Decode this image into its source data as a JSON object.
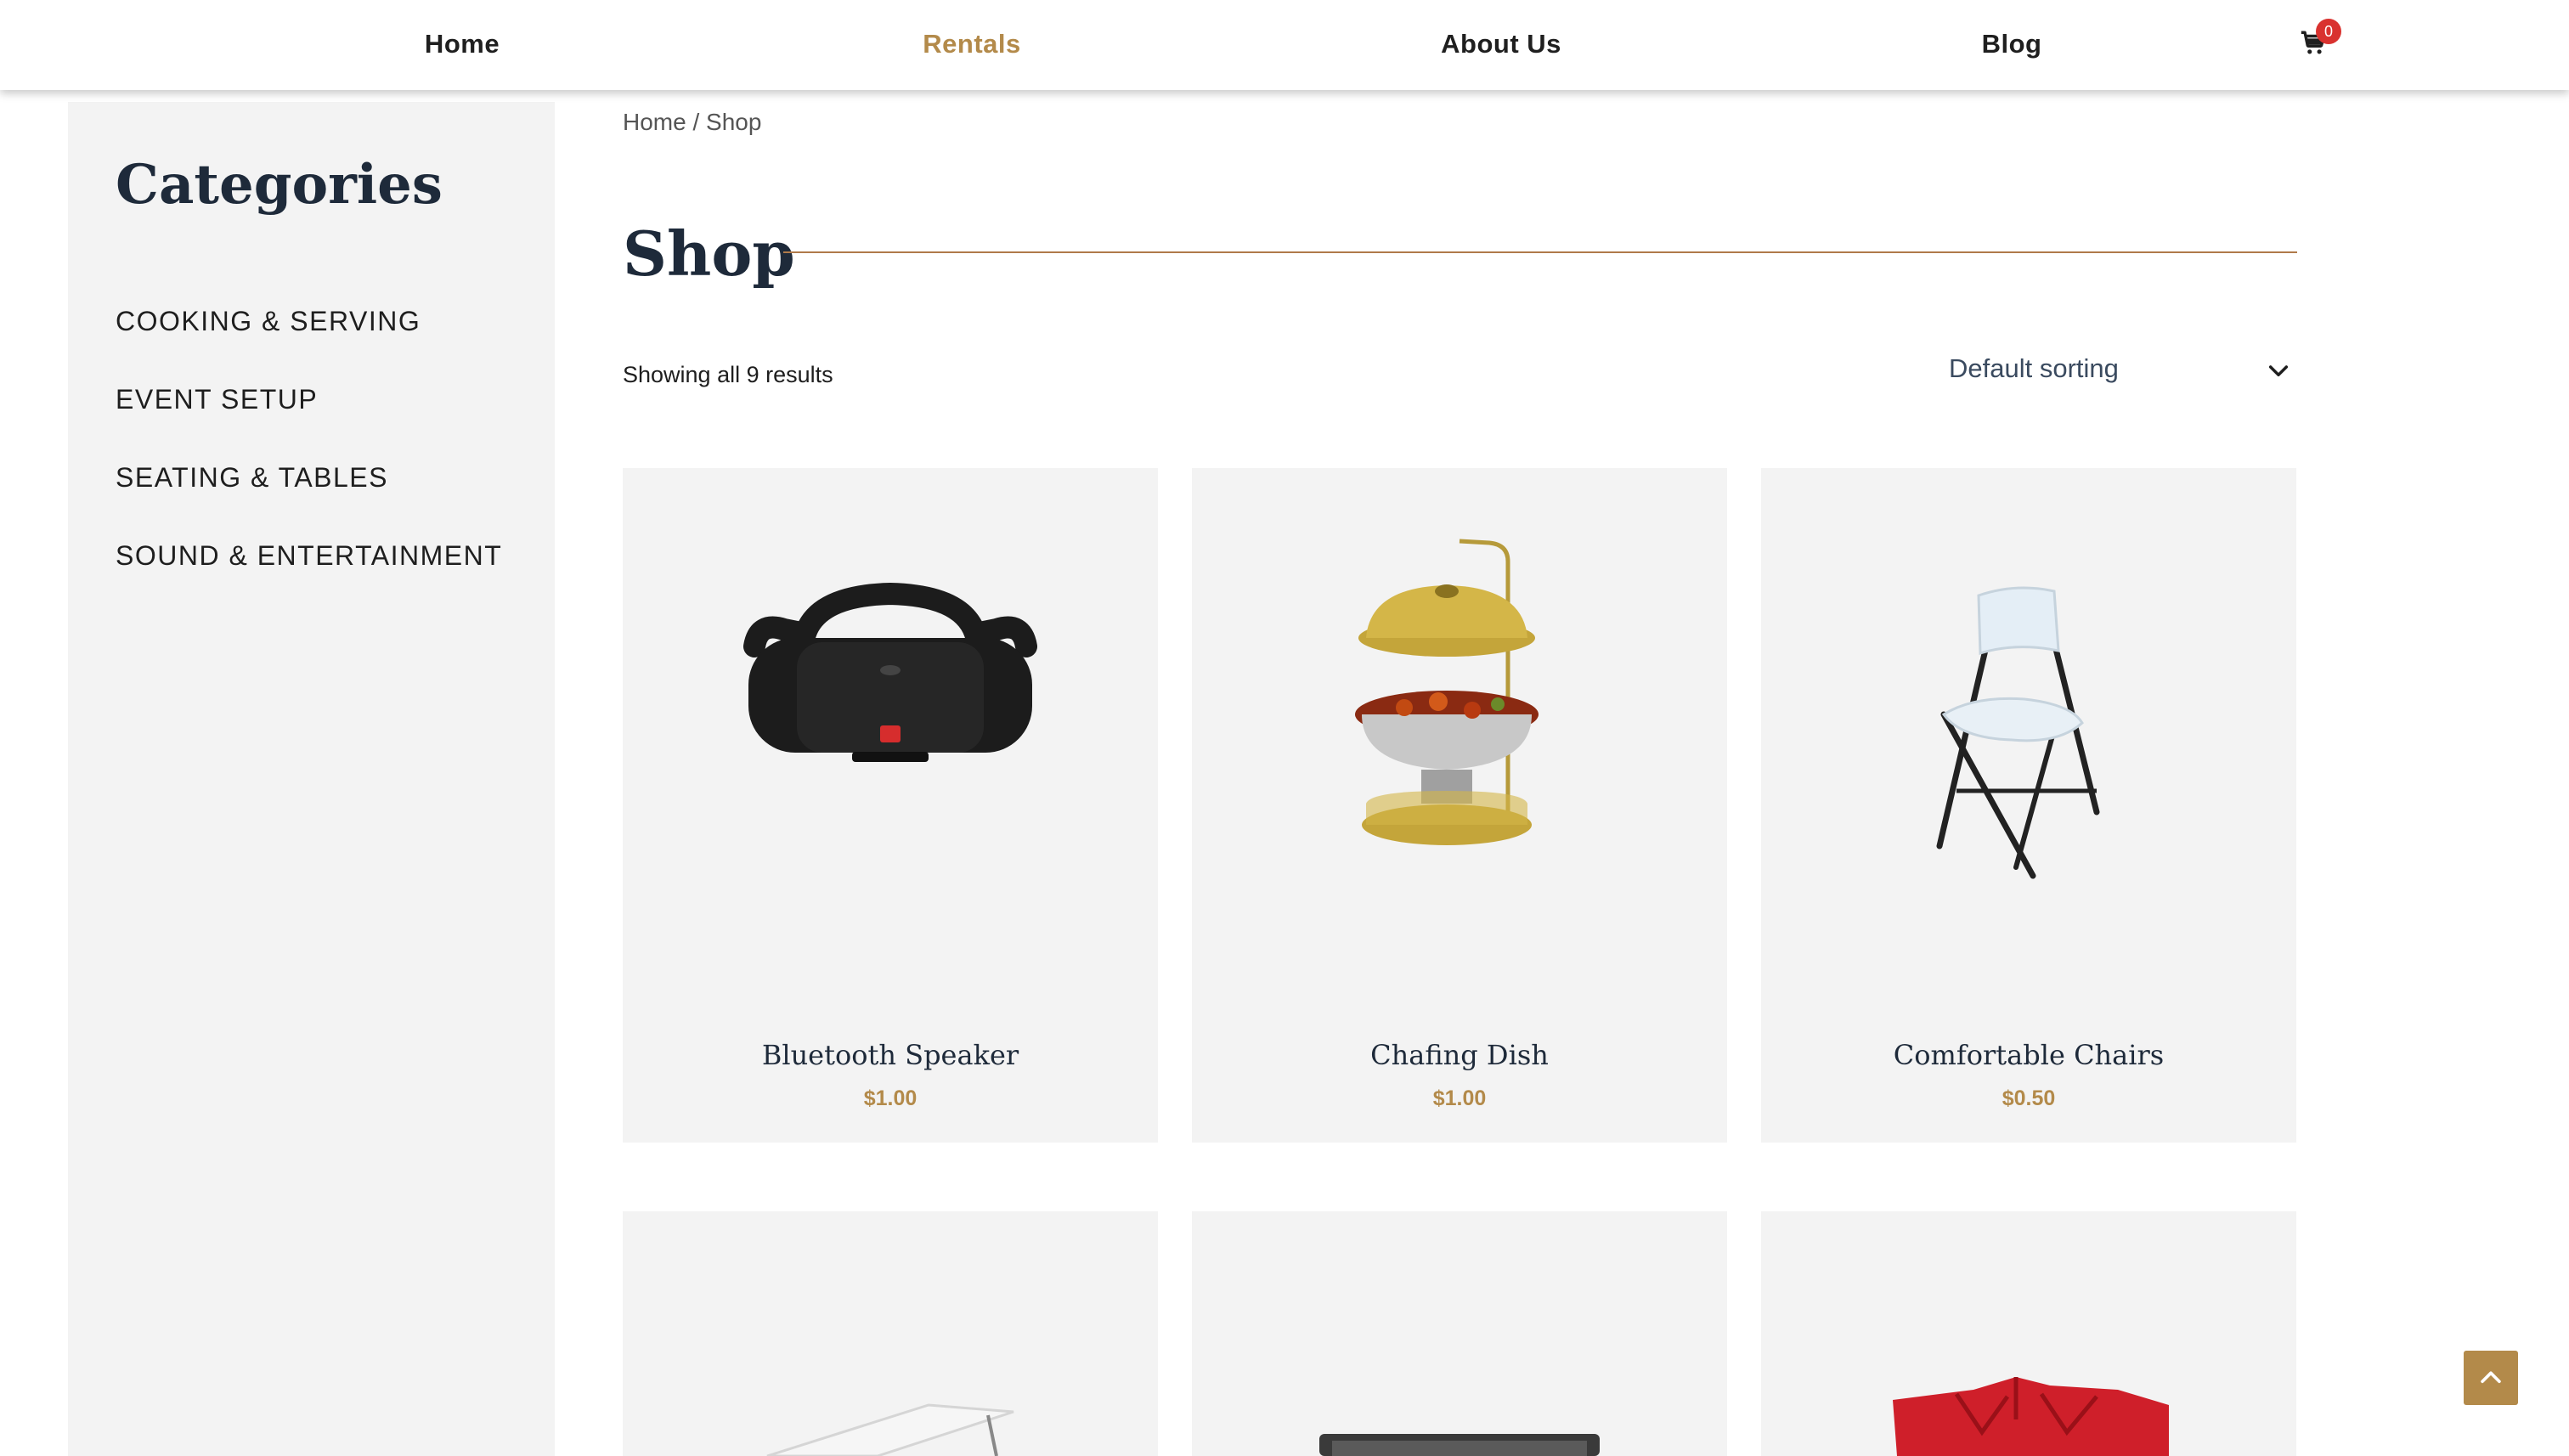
{
  "nav": {
    "items": [
      {
        "label": "Home",
        "active": false
      },
      {
        "label": "Rentals",
        "active": true
      },
      {
        "label": "About Us",
        "active": false
      },
      {
        "label": "Blog",
        "active": false
      }
    ],
    "cart_count": "0"
  },
  "sidebar": {
    "title": "Categories",
    "items": [
      {
        "label": "COOKING & SERVING"
      },
      {
        "label": "EVENT SETUP"
      },
      {
        "label": "SEATING & TABLES"
      },
      {
        "label": "SOUND & ENTERTAINMENT"
      }
    ]
  },
  "breadcrumb": {
    "home": "Home",
    "separator": " / ",
    "current": "Shop"
  },
  "shop": {
    "title": "Shop",
    "results": "Showing all 9 results",
    "sort_label": "Default sorting"
  },
  "products": [
    {
      "name": "Bluetooth Speaker",
      "price": "$1.00"
    },
    {
      "name": "Chafing Dish",
      "price": "$1.00"
    },
    {
      "name": "Comfortable Chairs",
      "price": "$0.50"
    },
    {
      "name": "",
      "price": ""
    },
    {
      "name": "",
      "price": ""
    },
    {
      "name": "",
      "price": ""
    }
  ],
  "colors": {
    "accent": "#b38a4a",
    "heading": "#1e2a3a",
    "badge": "#d9322f",
    "card_bg": "#f3f3f3"
  }
}
